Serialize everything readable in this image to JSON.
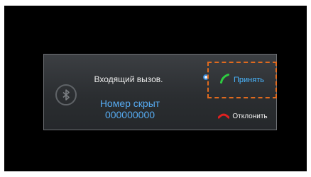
{
  "dialog": {
    "title": "Входящий вызов.",
    "number_label": "Номер скрыт",
    "number_value": "000000000"
  },
  "actions": {
    "accept_label": "Принять",
    "reject_label": "Отклонить"
  },
  "icons": {
    "bluetooth": "bluetooth-icon",
    "accept": "phone-accept-icon",
    "reject": "phone-reject-icon",
    "selection": "selection-indicator"
  },
  "colors": {
    "accent_blue": "#56aaf0",
    "accept_green": "#2ecc40",
    "reject_red": "#e02020",
    "highlight_orange": "#e06a1e"
  }
}
